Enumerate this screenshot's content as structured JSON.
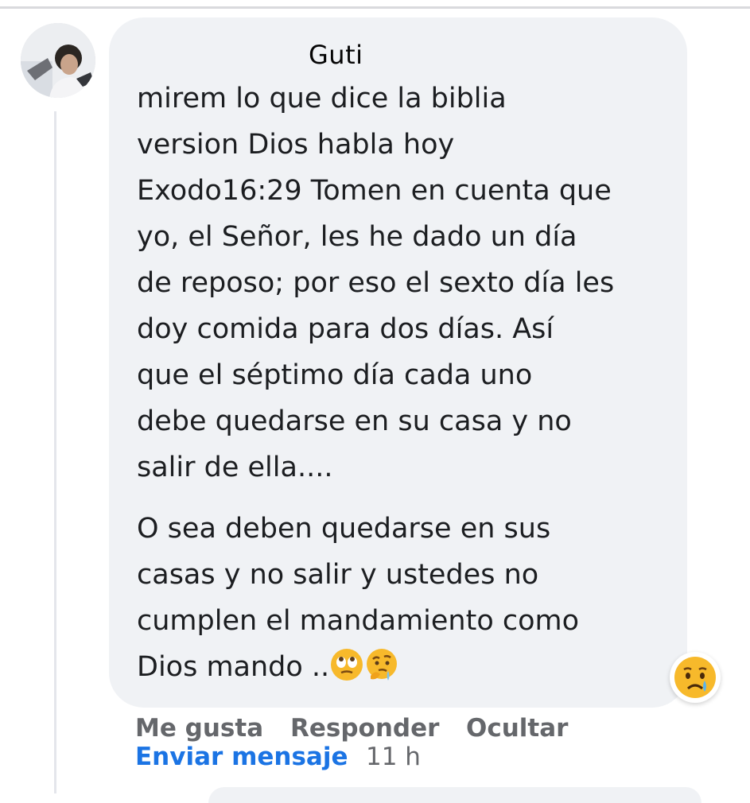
{
  "comment": {
    "author": "Guti",
    "paragraphs": [
      "mirem lo que dice la biblia\nversion Dios habla hoy\nExodo16:29 Tomen en cuenta que\nyo, el Señor, les he dado un día\nde reposo; por eso el sexto día les\ndoy comida para dos días. Así\nque el séptimo día cada uno\ndebe quedarse en su casa y no\nsalir de ella....",
      "O sea deben quedarse en sus\ncasas y no salir y ustedes no\ncumplen el mandamiento como\nDios mando .."
    ],
    "inline_emojis": [
      "rolling-eyes-emoji",
      "drooling-thinking-emoji"
    ],
    "reaction": "sad-reaction-icon"
  },
  "actions": {
    "like": "Me gusta",
    "reply": "Responder",
    "hide": "Ocultar",
    "send_message": "Enviar mensaje",
    "time": "11 h"
  },
  "colors": {
    "bubble": "#f0f2f5",
    "link": "#1b74e4",
    "muted": "#65676b"
  }
}
